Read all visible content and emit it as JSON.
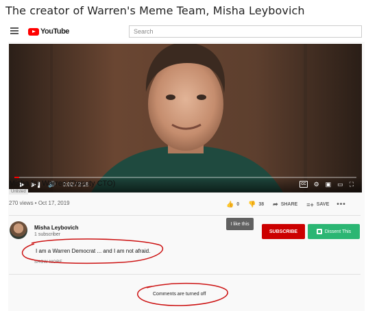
{
  "caption": "The creator of Warren's Meme Team, Misha Leybovich",
  "header": {
    "logo_text": "YouTube",
    "search_placeholder": "Search"
  },
  "player": {
    "time": "0:02 / 2:18",
    "progress_fraction": 0.0145
  },
  "video": {
    "title": "Misha for Warren (Deputy CTO)",
    "badge": "Unlisted",
    "meta": "270 views • Oct 17, 2019",
    "likes": "0",
    "dislikes": "38",
    "share_label": "SHARE",
    "save_label": "SAVE",
    "more": "•••",
    "tooltip": "I like this"
  },
  "channel": {
    "name": "Misha Leybovich",
    "subscribers": "1 subscriber",
    "subscribe_label": "SUBSCRIBE",
    "dissent_label": "Dissent This"
  },
  "description": {
    "text": "I am a Warren Democrat ... and I am not afraid.",
    "show_more": "SHOW MORE"
  },
  "comments": {
    "status": "Comments are turned off"
  },
  "colors": {
    "youtube_red": "#ff0000",
    "subscribe_red": "#cc0000",
    "dissent_green": "#2bb673",
    "annotation_red": "#cc1111"
  }
}
